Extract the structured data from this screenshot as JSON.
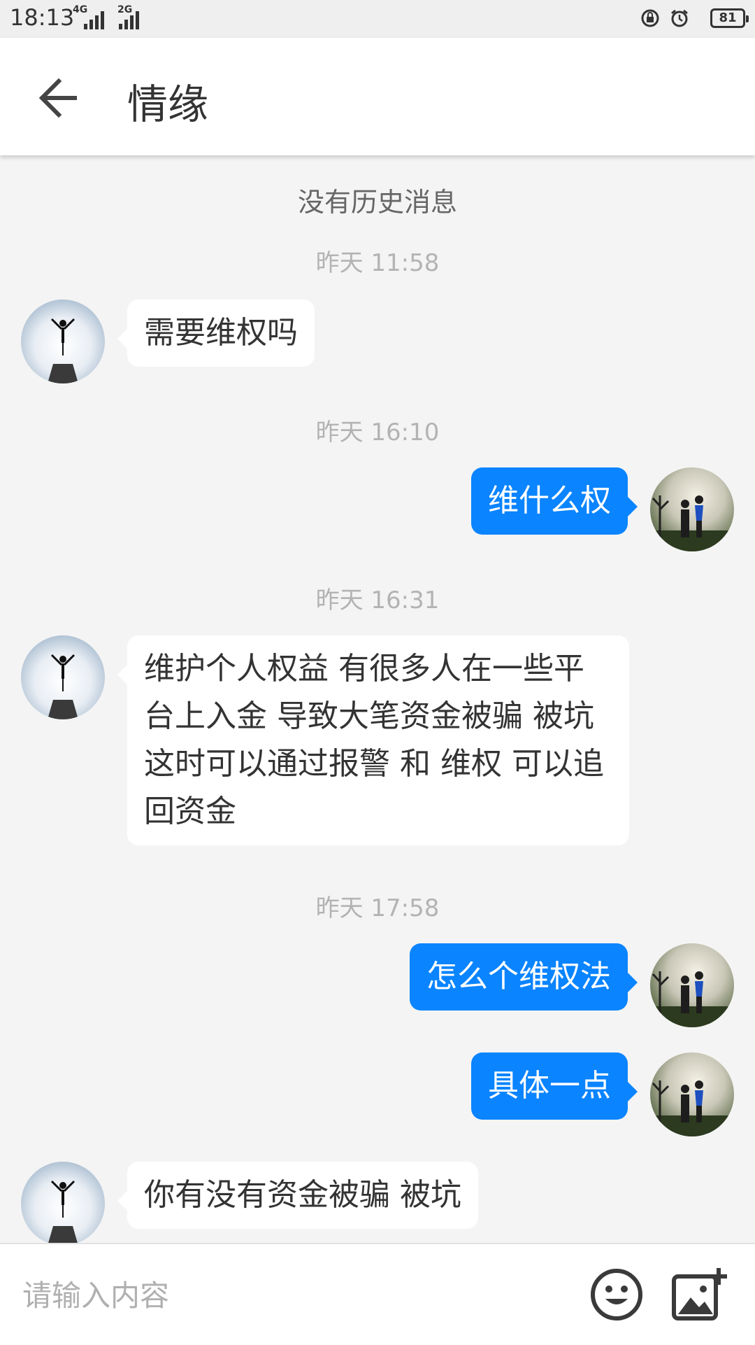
{
  "status_bar": {
    "time": "18:13",
    "net1": "4G",
    "net2": "2G",
    "battery": "81",
    "icons": [
      "signal-icon",
      "lock-rotation-icon",
      "alarm-icon",
      "battery-icon"
    ]
  },
  "header": {
    "title": "情缘",
    "back_icon": "arrow-left-icon"
  },
  "conversation": {
    "no_history": "没有历史消息",
    "messages": [
      {
        "timestamp": "昨天 11:58",
        "side": "left",
        "text": "需要维权吗"
      },
      {
        "timestamp": "昨天 16:10",
        "side": "right",
        "text": "维什么权"
      },
      {
        "timestamp": "昨天 16:31",
        "side": "left",
        "text": "维护个人权益 有很多人在一些平台上入金 导致大笔资金被骗 被坑 这时可以通过报警 和 维权 可以追回资金"
      },
      {
        "timestamp": "昨天 17:58",
        "side": "right",
        "text": "怎么个维权法"
      },
      {
        "timestamp": "",
        "side": "right",
        "text": "具体一点"
      },
      {
        "timestamp": "",
        "side": "left",
        "text": "你有没有资金被骗 被坑"
      }
    ]
  },
  "input_bar": {
    "placeholder": "请输入内容",
    "emoji_icon": "emoji-icon",
    "image_icon": "add-image-icon"
  },
  "colors": {
    "accent": "#0a84ff",
    "background": "#f4f4f4",
    "bubble_in": "#ffffff"
  }
}
